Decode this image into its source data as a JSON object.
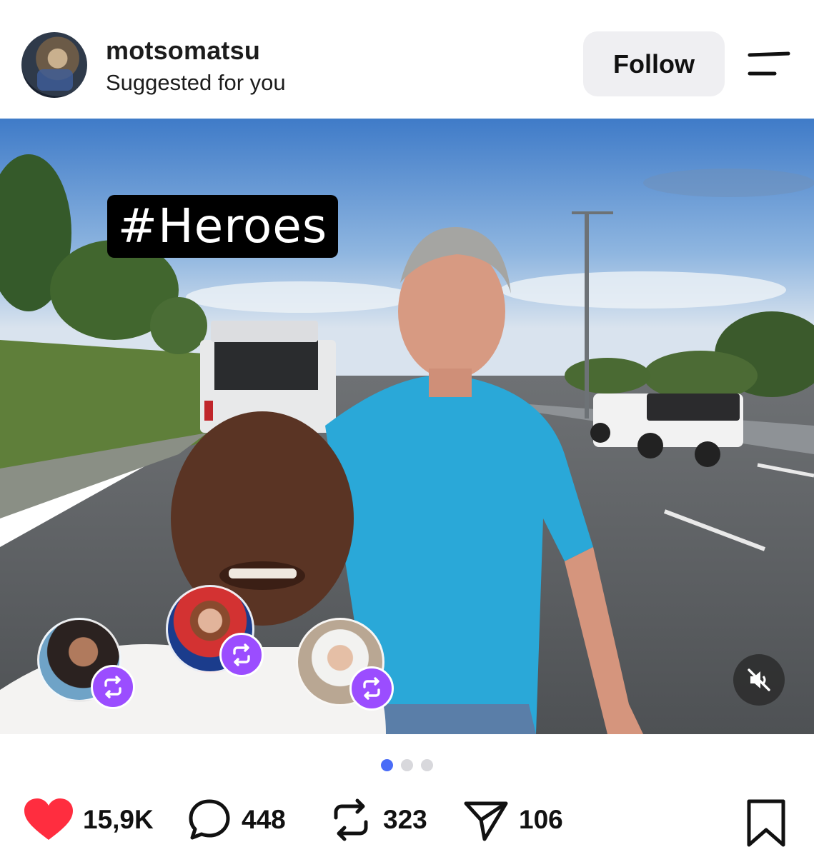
{
  "post": {
    "username": "motsomatsu",
    "subtitle": "Suggested for you",
    "follow_label": "Follow",
    "hashtag": "#Heroes"
  },
  "pager": {
    "count": 3,
    "active": 0
  },
  "actions": {
    "likes": "15,9K",
    "comments": "448",
    "reposts": "323",
    "shares": "106"
  },
  "colors": {
    "like": "#ff2d3f",
    "repost_badge": "#9b4dff",
    "pager_active": "#4a6cf7",
    "follow_bg": "#efeff2"
  },
  "icons": [
    "menu-icon",
    "heart-icon",
    "comment-icon",
    "repost-icon",
    "share-icon",
    "bookmark-icon",
    "mute-icon"
  ]
}
